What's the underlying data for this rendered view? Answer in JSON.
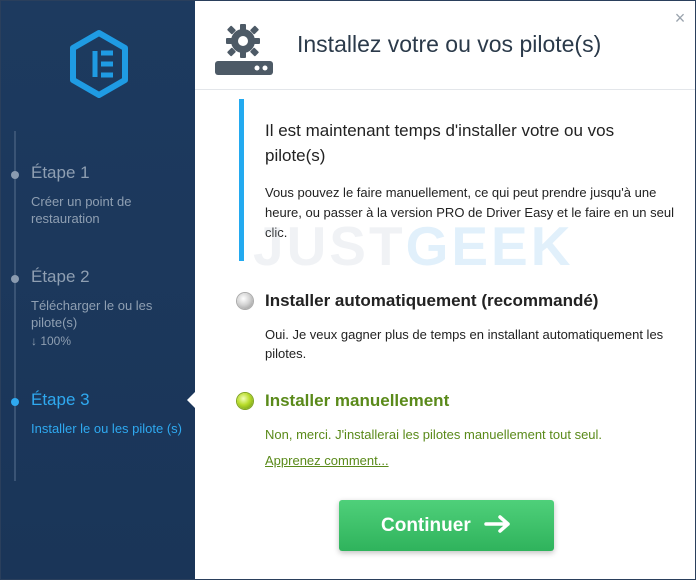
{
  "window": {
    "title": "Installez votre ou vos pilote(s)",
    "close_glyph": "×"
  },
  "sidebar": {
    "steps": [
      {
        "title": "Étape 1",
        "desc": "Créer un point de restauration",
        "state": "done"
      },
      {
        "title": "Étape 2",
        "desc": "Télécharger le ou les pilote(s)",
        "progress": "↓ 100%",
        "state": "done"
      },
      {
        "title": "Étape 3",
        "desc": "Installer le ou les pilote (s)",
        "state": "active"
      }
    ]
  },
  "info": {
    "title": "Il est maintenant temps d'installer votre ou vos pilote(s)",
    "text": "Vous pouvez le faire manuellement, ce qui peut prendre jusqu'à une heure, ou passer à la version PRO de Driver Easy et le faire en un seul clic."
  },
  "watermark": {
    "part1": "JUST",
    "part2": "GEEK"
  },
  "options": {
    "auto": {
      "label": "Installer automatiquement (recommandé)",
      "desc": "Oui. Je veux gagner plus de temps en installant automatiquement les pilotes.",
      "selected": false
    },
    "manual": {
      "label": "Installer manuellement",
      "desc": "Non, merci. J'installerai les pilotes manuellement tout seul.",
      "link": "Apprenez comment...",
      "selected": true
    }
  },
  "continue_button": {
    "label": "Continuer"
  },
  "colors": {
    "sidebar_bg": "#1d3a5f",
    "accent_blue": "#23aaf0",
    "selected_green": "#5a8a1a",
    "button_green": "#3cc168"
  },
  "icons": {
    "logo": "driver-easy-logo",
    "header": "gear-install-icon",
    "arrow": "arrow-right-icon"
  }
}
